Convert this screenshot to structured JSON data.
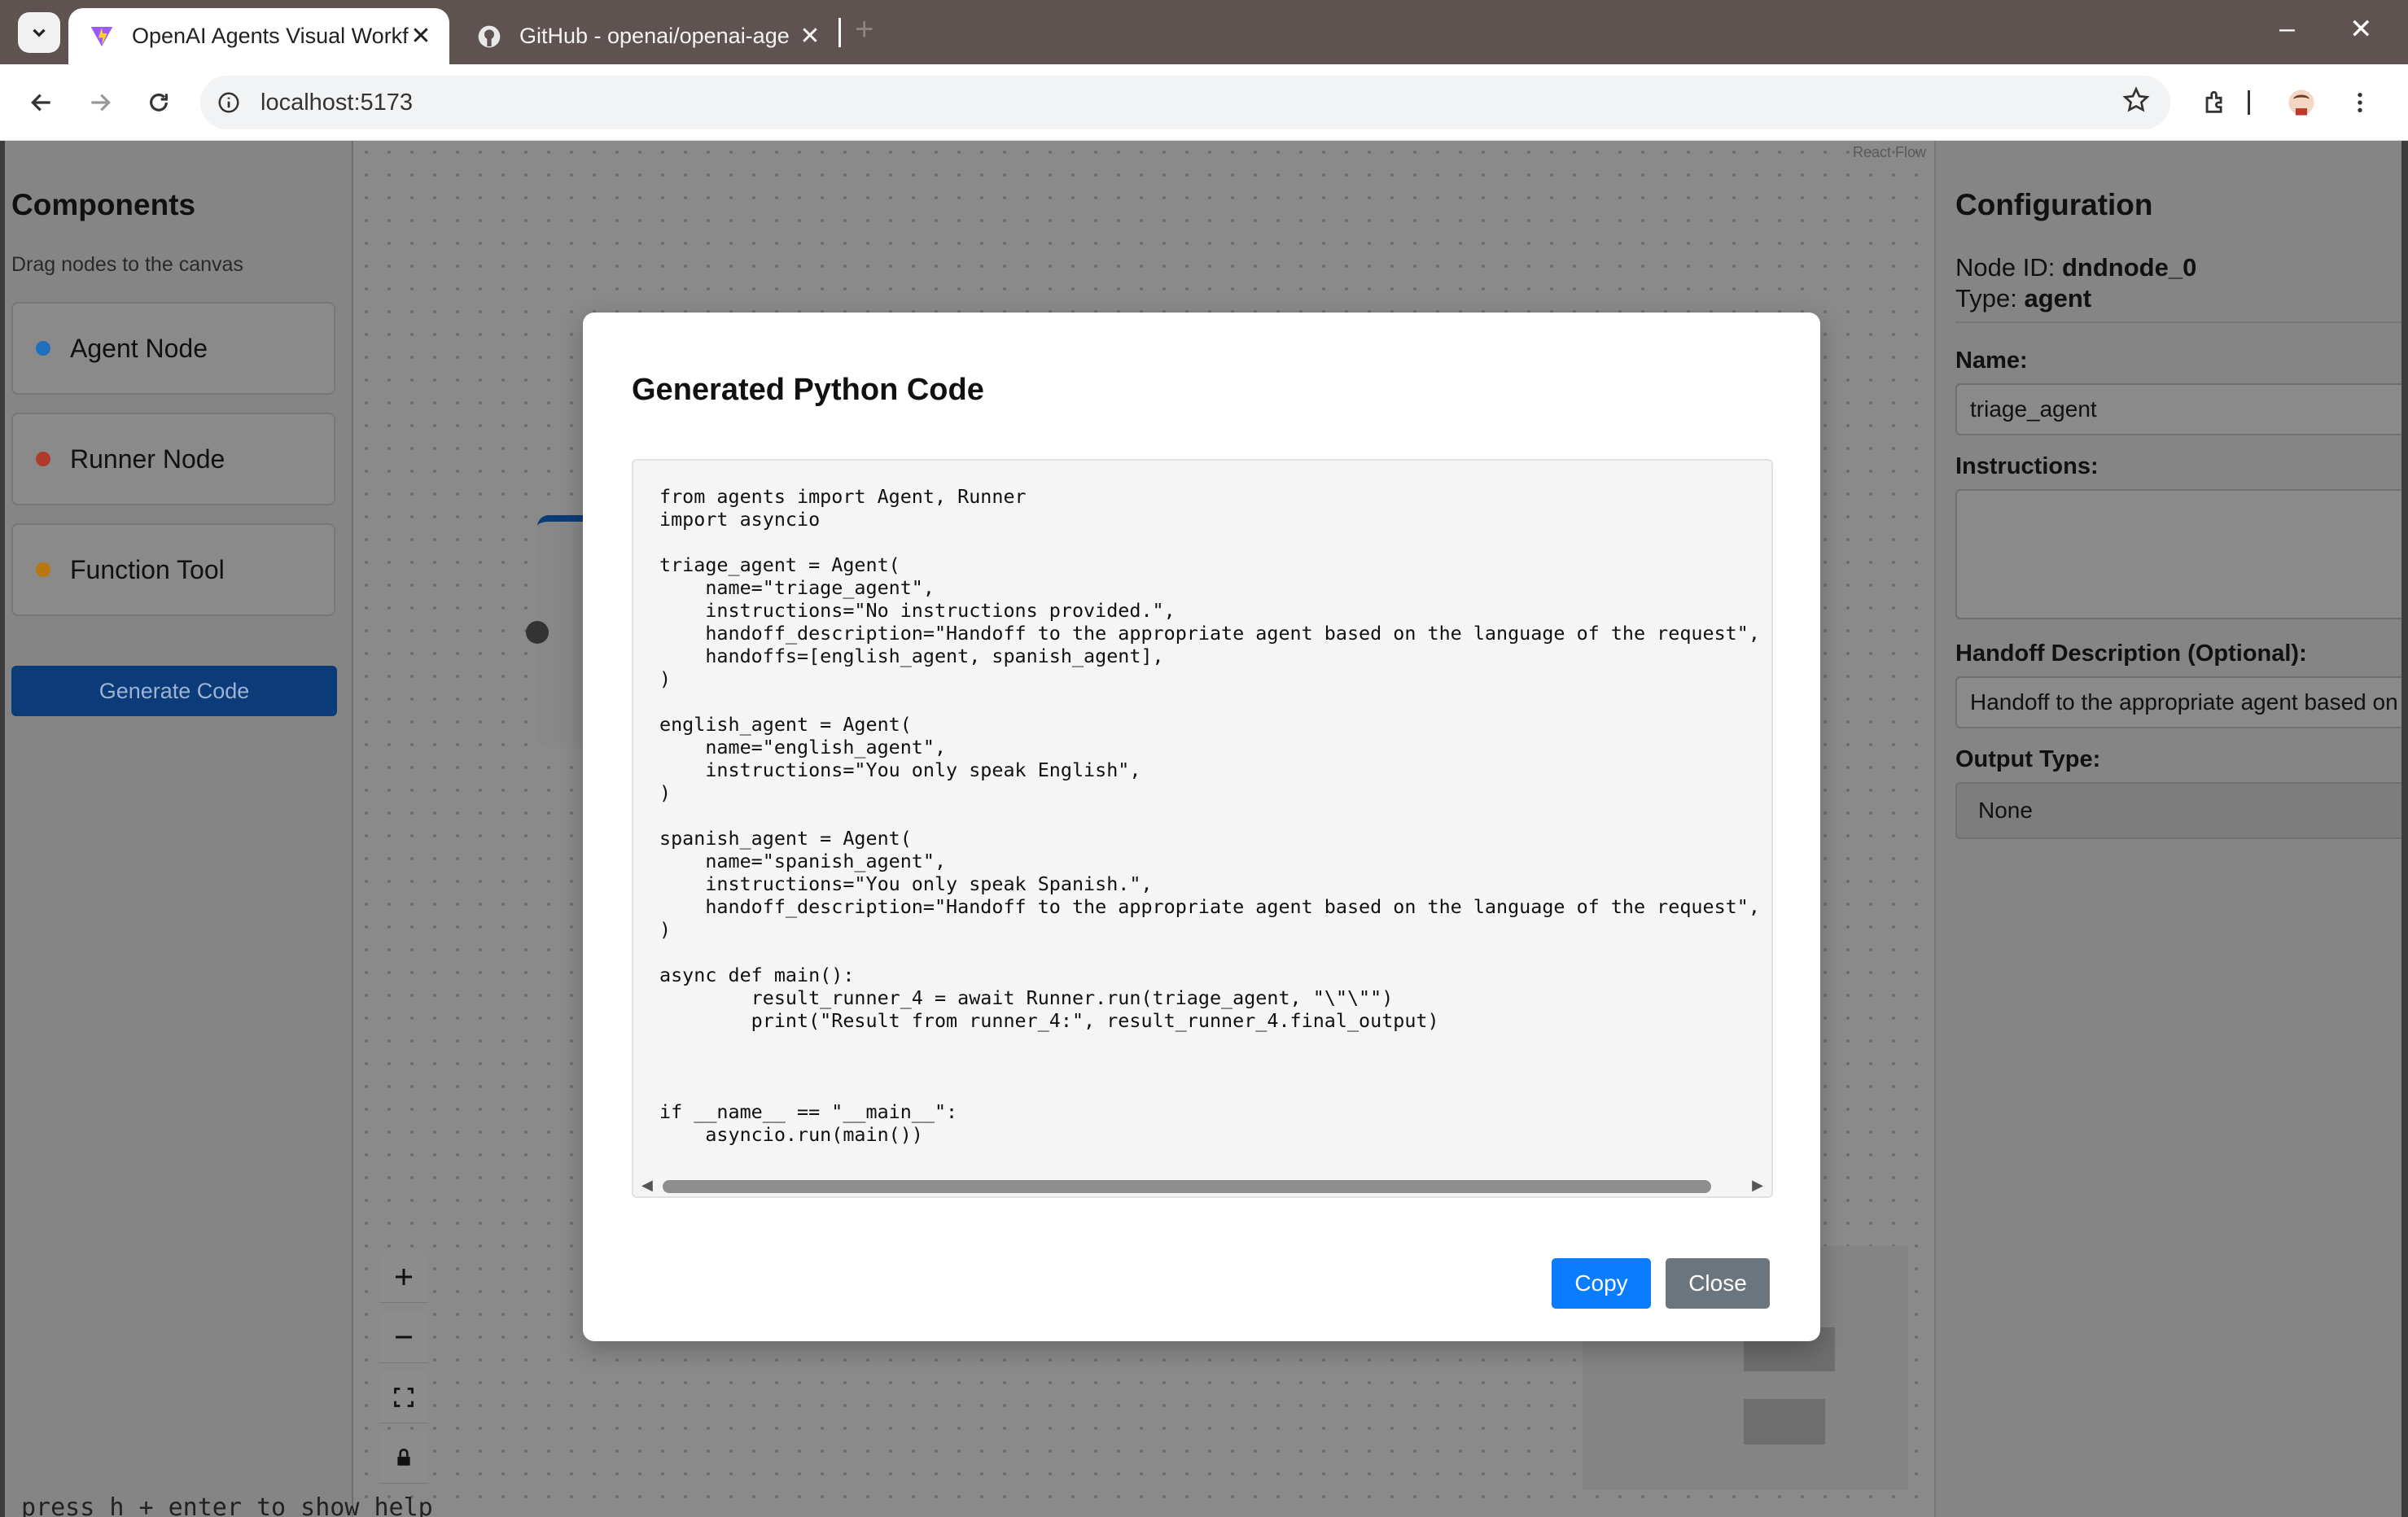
{
  "browser": {
    "tabs": [
      {
        "title": "OpenAI Agents Visual Workfl",
        "icon": "vite-icon",
        "active": true
      },
      {
        "title": "GitHub - openai/openai-age",
        "icon": "github-icon",
        "active": false
      }
    ],
    "url": "localhost:5173"
  },
  "left_panel": {
    "title": "Components",
    "hint": "Drag nodes to the canvas",
    "nodes": [
      {
        "label": "Agent Node",
        "color": "#1f6fbf"
      },
      {
        "label": "Runner Node",
        "color": "#c0392b"
      },
      {
        "label": "Function Tool",
        "color": "#d68910"
      }
    ],
    "generate_label": "Generate Code"
  },
  "canvas": {
    "attribution": "React Flow"
  },
  "right_panel": {
    "title": "Configuration",
    "node_id_label": "Node ID:",
    "node_id": "dndnode_0",
    "type_label": "Type:",
    "type": "agent",
    "name_label": "Name:",
    "name_value": "triage_agent",
    "instructions_label": "Instructions:",
    "instructions_value": "",
    "handoff_label": "Handoff Description (Optional):",
    "handoff_value": "Handoff to the appropriate agent based on the language of the request",
    "output_type_label": "Output Type:",
    "output_type_value": "None"
  },
  "background_terminal": "press h + enter to show help",
  "modal": {
    "title": "Generated Python Code",
    "code": "from agents import Agent, Runner\nimport asyncio\n\ntriage_agent = Agent(\n    name=\"triage_agent\",\n    instructions=\"No instructions provided.\",\n    handoff_description=\"Handoff to the appropriate agent based on the language of the request\",\n    handoffs=[english_agent, spanish_agent],\n)\n\nenglish_agent = Agent(\n    name=\"english_agent\",\n    instructions=\"You only speak English\",\n)\n\nspanish_agent = Agent(\n    name=\"spanish_agent\",\n    instructions=\"You only speak Spanish.\",\n    handoff_description=\"Handoff to the appropriate agent based on the language of the request\",\n)\n\nasync def main():\n        result_runner_4 = await Runner.run(triage_agent, \"\\\"\\\"\")\n        print(\"Result from runner_4:\", result_runner_4.final_output)\n\n\n\nif __name__ == \"__main__\":\n    asyncio.run(main())",
    "copy_label": "Copy",
    "close_label": "Close"
  }
}
